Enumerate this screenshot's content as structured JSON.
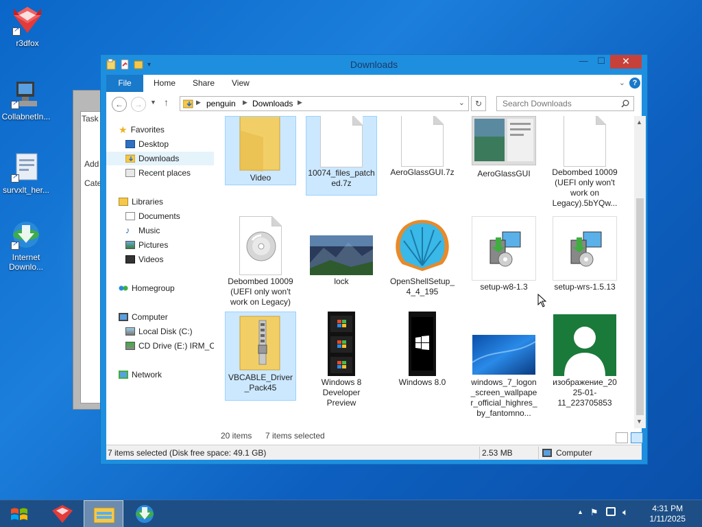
{
  "desktop": {
    "icons": [
      {
        "label": "r3dfox"
      },
      {
        "label": "CollabnetIn..."
      },
      {
        "label": "survxlt_her..."
      },
      {
        "label": "Internet Downlo..."
      }
    ]
  },
  "back_window": {
    "texts": [
      "Task",
      "Add",
      "Cate"
    ]
  },
  "window": {
    "title": "Downloads",
    "controls": {
      "minimize": "—",
      "maximize": "☐",
      "close": "✕"
    },
    "ribbon_tabs": [
      "File",
      "Home",
      "Share",
      "View"
    ],
    "address": {
      "segments": [
        "penguin",
        "Downloads"
      ]
    },
    "search": {
      "placeholder": "Search Downloads"
    },
    "nav": {
      "favorites": "Favorites",
      "desktop": "Desktop",
      "downloads": "Downloads",
      "recent": "Recent places",
      "libraries": "Libraries",
      "documents": "Documents",
      "music": "Music",
      "pictures": "Pictures",
      "videos": "Videos",
      "homegroup": "Homegroup",
      "computer": "Computer",
      "local_disk": "Local Disk (C:)",
      "cd_drive": "CD Drive (E:) IRM_CE",
      "network": "Network"
    },
    "files": [
      {
        "name": "Video",
        "selected": true
      },
      {
        "name": "10074_files_patched.7z",
        "selected": true
      },
      {
        "name": "AeroGlassGUI.7z",
        "selected": false
      },
      {
        "name": "AeroGlassGUI",
        "selected": false
      },
      {
        "name": "Debombed 10009 (UEFI only won't work on Legacy).5bYQw...",
        "selected": false
      },
      {
        "name": "Debombed 10009 (UEFI only won't work on Legacy)",
        "selected": false
      },
      {
        "name": "lock",
        "selected": false
      },
      {
        "name": "OpenShellSetup_4_4_195",
        "selected": false
      },
      {
        "name": "setup-w8-1.3",
        "selected": false
      },
      {
        "name": "setup-wrs-1.5.13",
        "selected": false
      },
      {
        "name": "VBCABLE_Driver_Pack45",
        "selected": true
      },
      {
        "name": "Windows 8 Developer Preview",
        "selected": false
      },
      {
        "name": "Windows 8.0",
        "selected": false
      },
      {
        "name": "windows_7_logon_screen_wallpaper_official_highres_by_fantomno...",
        "selected": false
      },
      {
        "name": "изображение_2025-01-11_223705853",
        "selected": false
      }
    ],
    "item_count": "20 items",
    "selected_count": "7 items selected",
    "statusbar": {
      "selection": "7 items selected (Disk free space: 49.1 GB)",
      "size": "2.53 MB",
      "location": "Computer"
    }
  },
  "taskbar": {
    "time": "4:31 PM",
    "date": "1/11/2025"
  },
  "colors": {
    "accent": "#1979ca",
    "selection": "#cce8ff",
    "close_button": "#c7413b",
    "taskbar": "#1d4f86"
  }
}
